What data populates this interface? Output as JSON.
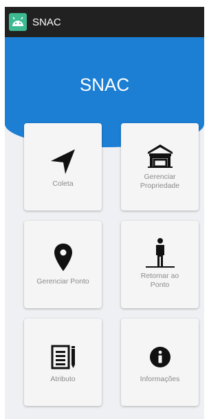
{
  "action_bar": {
    "title": "SNAC",
    "icon": "android-icon"
  },
  "header": {
    "title": "SNAC",
    "color": "#1c7fd4"
  },
  "cards": [
    {
      "label_line1": "Coleta",
      "label_line2": "",
      "icon": "navigation-arrow-icon"
    },
    {
      "label_line1": "Gerenciar",
      "label_line2": "Propriedade",
      "icon": "barn-icon"
    },
    {
      "label_line1": "Gerenciar Ponto",
      "label_line2": "",
      "icon": "map-pin-icon"
    },
    {
      "label_line1": "Retornar ao",
      "label_line2": "Ponto",
      "icon": "person-standing-icon"
    },
    {
      "label_line1": "Atributo",
      "label_line2": "",
      "icon": "notes-pencil-icon"
    },
    {
      "label_line1": "Informações",
      "label_line2": "",
      "icon": "info-icon"
    }
  ]
}
